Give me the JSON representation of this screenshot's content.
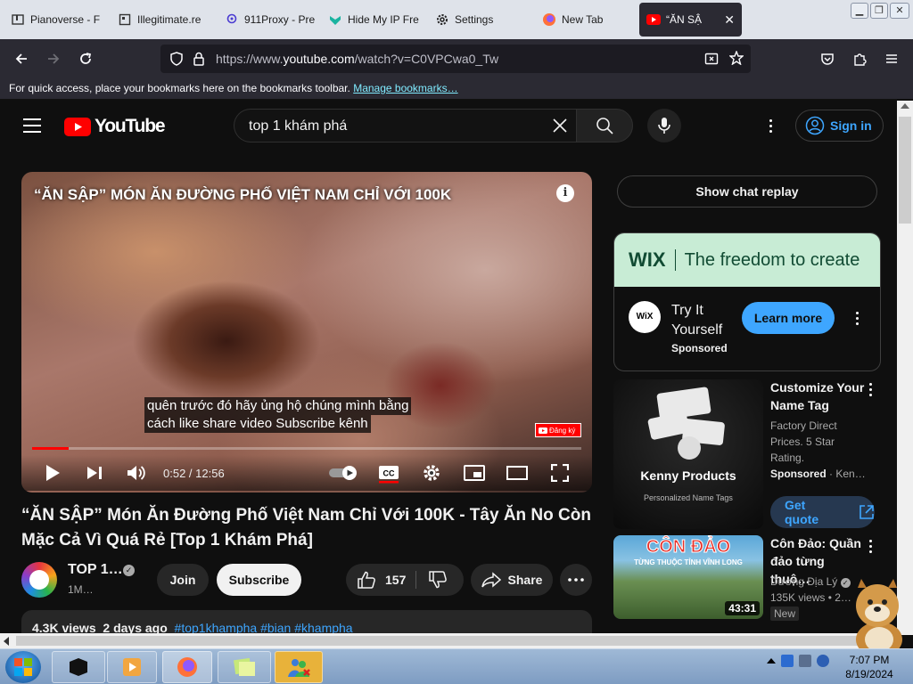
{
  "browser": {
    "tabs": [
      {
        "label": "Pianoverse - F",
        "icon": "pianoverse-icon"
      },
      {
        "label": "Illegitimate.re",
        "icon": "page-icon"
      },
      {
        "label": "911Proxy - Pre",
        "icon": "location-pin-icon"
      },
      {
        "label": "Hide My IP Fre",
        "icon": "hidemyip-icon"
      },
      {
        "label": "Settings",
        "icon": "gear-icon"
      },
      {
        "label": "New Tab",
        "icon": "firefox-icon"
      },
      {
        "label": "“ĂN SẬ",
        "icon": "youtube-icon",
        "active": true
      }
    ],
    "url_prefix": "https://www.",
    "url_host": "youtube.com",
    "url_rest": "/watch?v=C0VPCwa0_Tw",
    "bookmarks_hint": "For quick access, place your bookmarks here on the bookmarks toolbar.",
    "bookmarks_link": "Manage bookmarks…"
  },
  "youtube": {
    "logo_text": "YouTube",
    "search_query": "top 1 khám phá",
    "sign_in": "Sign in",
    "player": {
      "overlay_title": "“ĂN SẬP” MÓN ĂN ĐƯỜNG PHỐ VIỆT NAM CHỈ VỚI 100K",
      "caption_line1": "quên trước đó hãy ủng hộ chúng mình bằng",
      "caption_line2": "cách like share video Subscribe kênh",
      "subscribe_badge": "Đăng ký",
      "time": "0:52 / 12:56",
      "progress": 0.067
    },
    "video_title": "“ĂN SẬP” Món Ăn Đường Phố Việt Nam Chỉ Với 100K - Tây Ăn No Còn Mặc Cả Vì Quá Rẻ [Top 1 Khám Phá]",
    "channel_name": "TOP 1…",
    "channel_subs": "1M…",
    "join": "Join",
    "subscribe": "Subscribe",
    "likes": "157",
    "share": "Share",
    "description": {
      "views": "4.3K views",
      "date": "2 days ago",
      "tags": "#top1khampha #bian #khampha"
    },
    "right": {
      "chat_replay": "Show chat replay",
      "ad": {
        "brand": "WIX",
        "tagline": "The freedom to create",
        "logo_text": "WiX",
        "title": "Try It Yourself",
        "sponsored": "Sponsored",
        "cta": "Learn more"
      },
      "kenny": {
        "thumb_title": "Kenny Products",
        "thumb_sub": "Personalized Name Tags",
        "title": "Customize Your Name Tag",
        "desc": "Factory Direct Prices. 5 Star Rating.",
        "sponsored": "Sponsored",
        "advertiser": "Ken…",
        "cta": "Get quote"
      },
      "condao": {
        "thumb_title": "CÔN ĐẢO",
        "thumb_sub": "TỪNG THUỘC TỈNH VĨNH LONG",
        "duration": "43:31",
        "title": "Côn Đảo: Quần đảo từng thuộ…",
        "channel": "Dương Địa Lý",
        "meta": "135K views • 2…",
        "badge": "New"
      }
    }
  },
  "taskbar": {
    "time": "7:07 PM",
    "date": "8/19/2024"
  },
  "colors": {
    "youtube_red": "#ff0000",
    "link_blue": "#3ea6ff",
    "wix_green_bg": "#c8ecd5"
  }
}
